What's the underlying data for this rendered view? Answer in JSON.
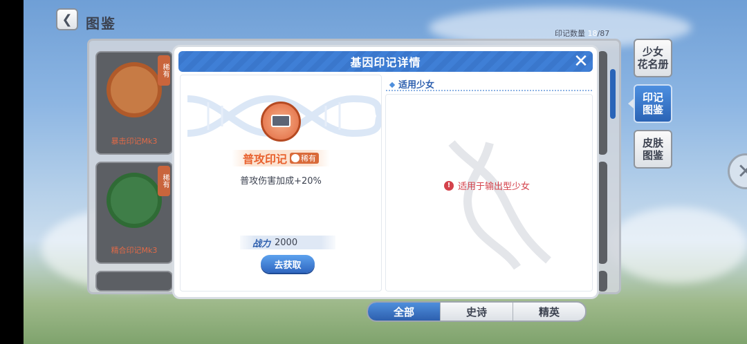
{
  "header": {
    "title": "图鉴",
    "back_icon": "chevron-left-icon"
  },
  "collection": {
    "label": "印记数量",
    "current": "18",
    "total": "/87"
  },
  "cards": [
    {
      "name": "暴击印记Mk3",
      "rarity": "稀有"
    },
    {
      "name": "精合印记Mk3",
      "rarity": "稀有"
    },
    {
      "name": "",
      "rarity": ""
    }
  ],
  "side_menu": [
    {
      "label": "少女\n花名册",
      "active": false
    },
    {
      "label": "印记\n图鉴",
      "active": true
    },
    {
      "label": "皮肤\n图鉴",
      "active": false
    }
  ],
  "tabs": [
    {
      "label": "全部",
      "active": true
    },
    {
      "label": "史诗",
      "active": false
    },
    {
      "label": "精英",
      "active": false
    }
  ],
  "dialog": {
    "title": "基因印记详情",
    "item": {
      "name": "普攻印记",
      "rarity": "稀有",
      "description": "普攻伤害加成+20%",
      "power_label": "战力",
      "power_value": "2000",
      "get_button": "去获取"
    },
    "applicable": {
      "title": "适用少女",
      "notice": "适用于输出型少女"
    }
  },
  "colors": {
    "accent": "#3a77cc",
    "rarity": "#d96a39",
    "warning": "#d4424b"
  }
}
